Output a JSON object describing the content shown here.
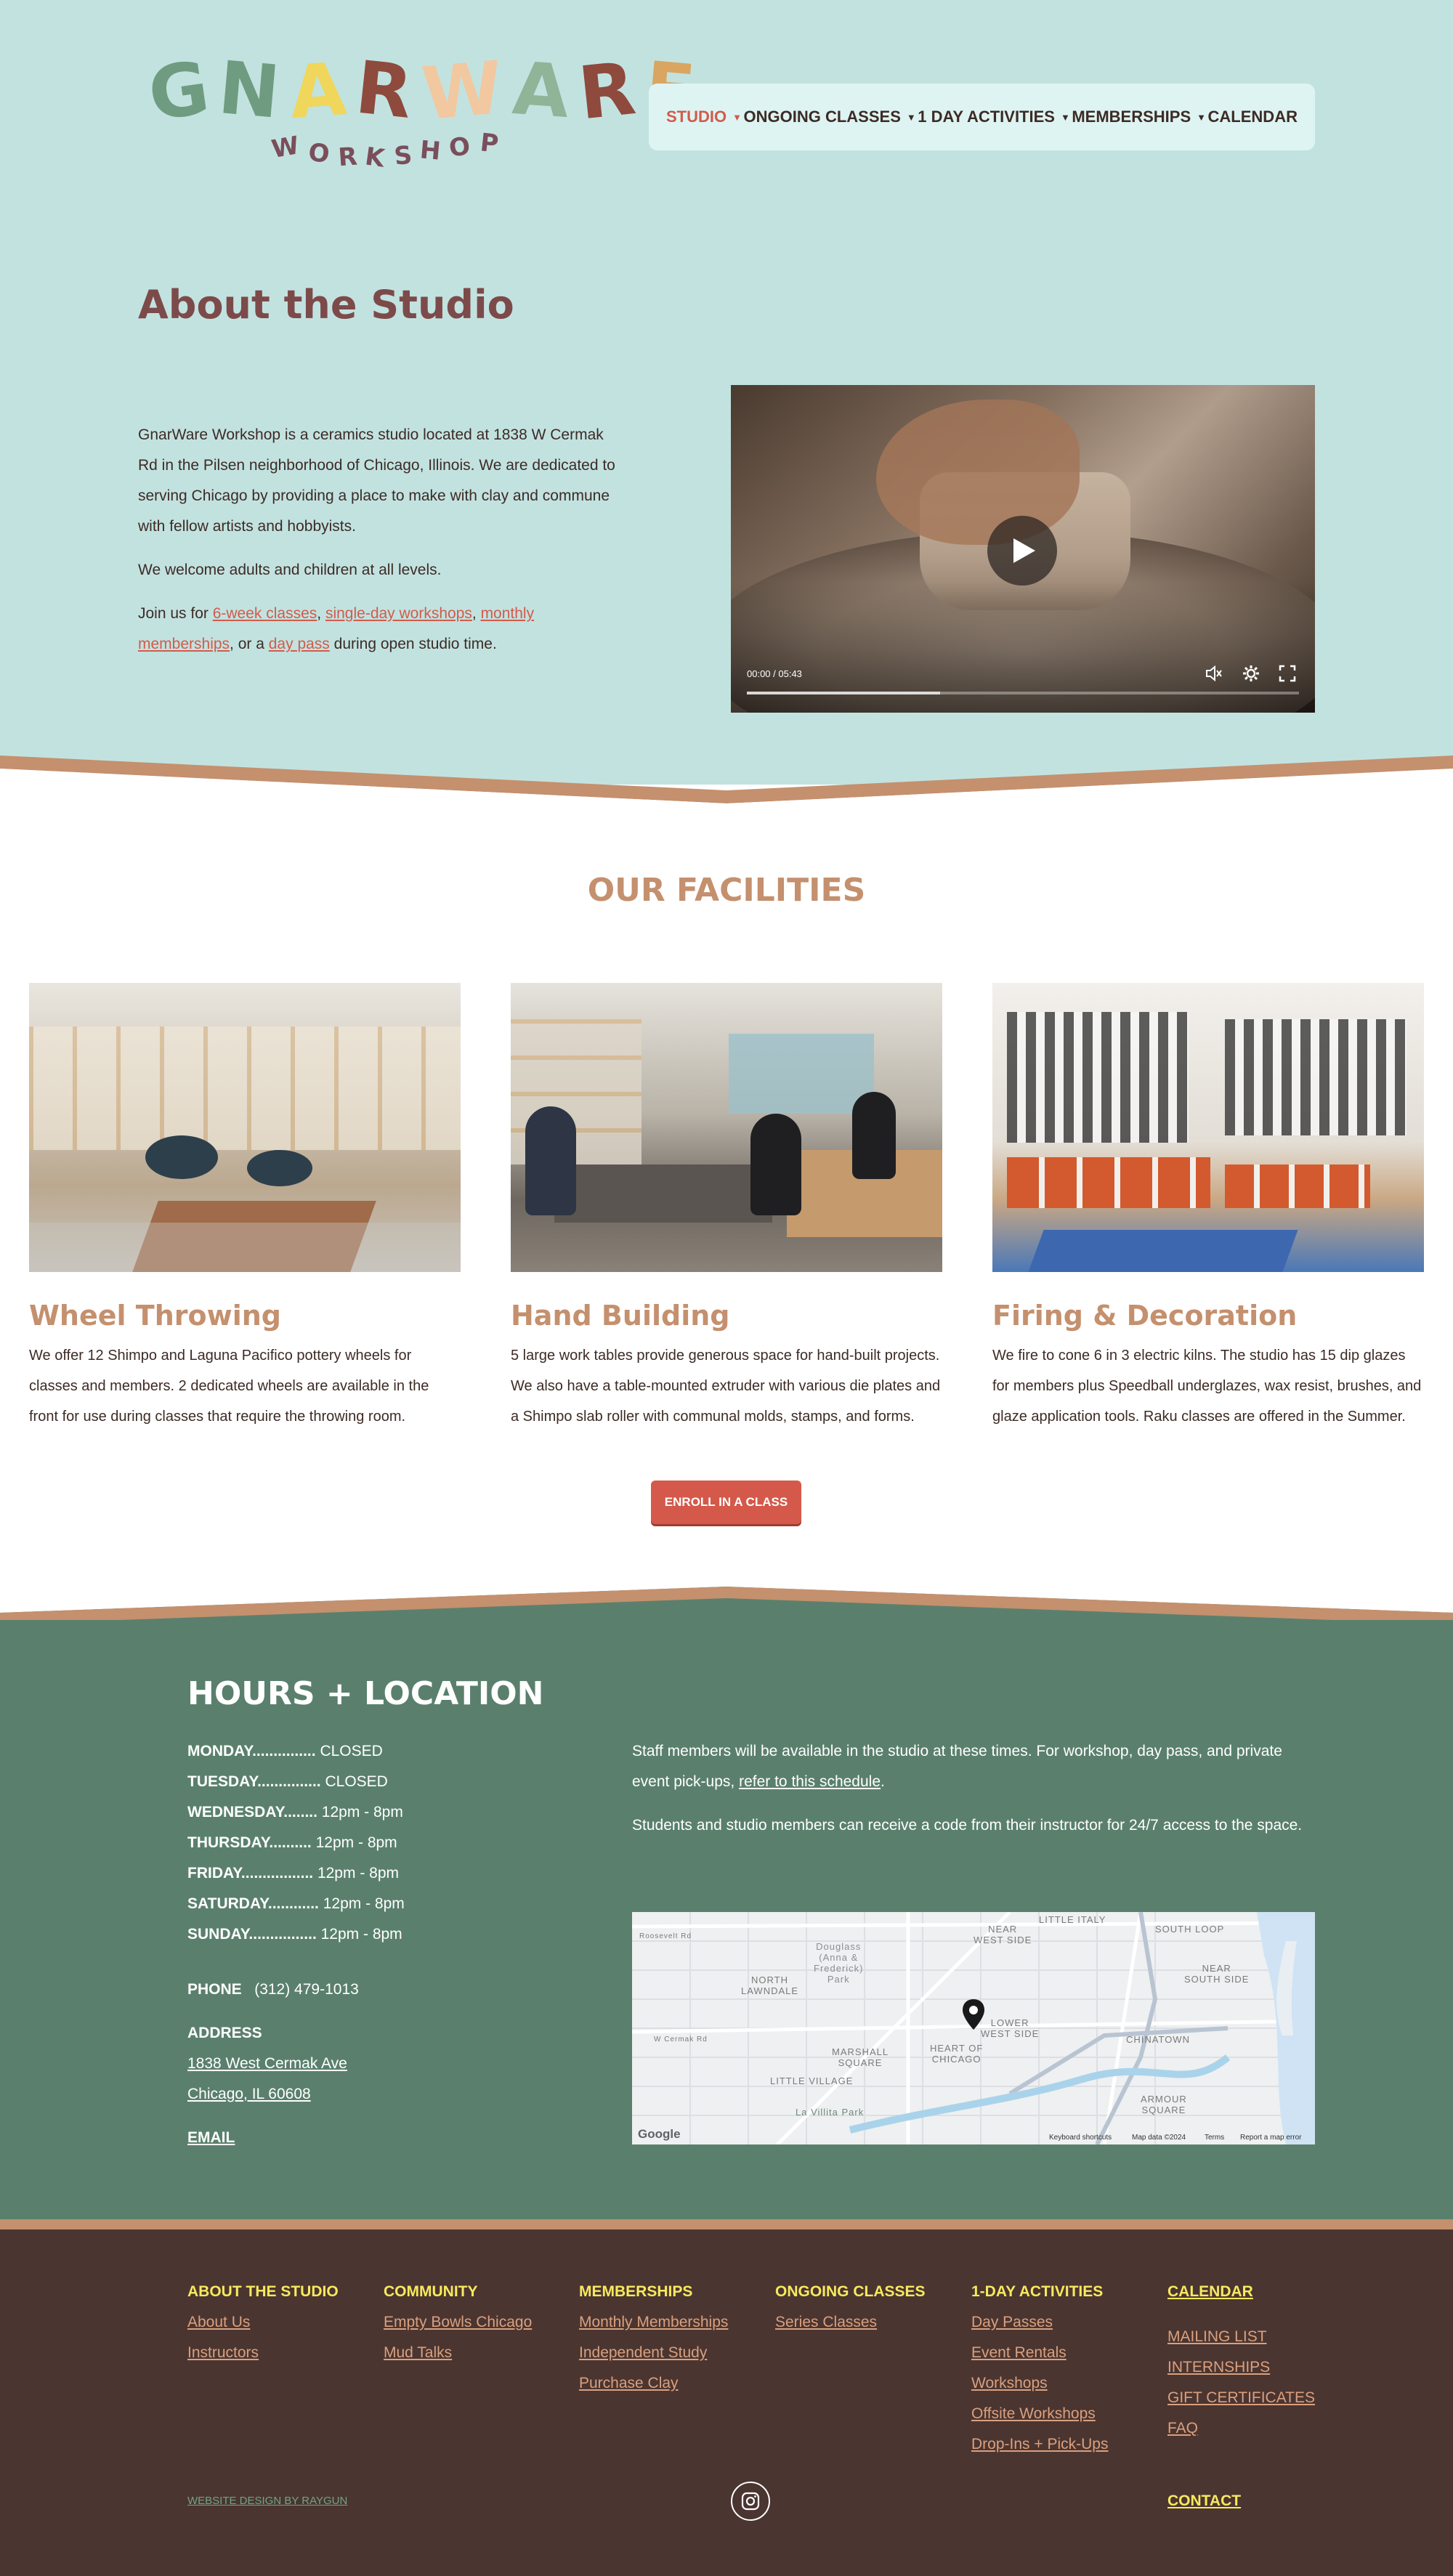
{
  "colors": {
    "hero_bg": "#c2e2e0",
    "accent_red": "#d25b4a",
    "tan": "#c4906e",
    "green": "#5a806d",
    "footer_bg": "#4b3530",
    "footer_heading": "#f6ea5e"
  },
  "logo": {
    "title": "GNARWARE",
    "subtitle": "WORKSHOP"
  },
  "nav": {
    "items": [
      {
        "label": "STUDIO",
        "active": true,
        "dropdown": true
      },
      {
        "label": "ONGOING CLASSES",
        "active": false,
        "dropdown": true
      },
      {
        "label": "1 DAY ACTIVITIES",
        "active": false,
        "dropdown": true
      },
      {
        "label": "MEMBERSHIPS",
        "active": false,
        "dropdown": true
      },
      {
        "label": "CALENDAR",
        "active": false,
        "dropdown": false
      }
    ],
    "caret_icon": "caret-down-icon"
  },
  "about": {
    "title": "About the Studio",
    "para1": "GnarWare Workshop is a ceramics studio located at 1838 W Cermak Rd in the Pilsen neighborhood of Chicago, Illinois. We are dedicated to serving Chicago by providing a place to make with clay and commune with fellow artists and hobbyists.",
    "para2": "We welcome adults and children at all levels.",
    "para3_prefix": "Join us for ",
    "link_classes": "6-week classes",
    "sep1": ", ",
    "link_workshops": "single-day workshops",
    "sep2": ", ",
    "link_memberships": "monthly memberships",
    "sep3": ", or a ",
    "link_daypass": "day pass",
    "para3_suffix": " during open studio time."
  },
  "video": {
    "time": "00:00 / 05:43",
    "progress": 0.35,
    "play_icon": "play-icon",
    "mute_icon": "speaker-icon",
    "settings_icon": "gear-icon",
    "fullscreen_icon": "fullscreen-icon"
  },
  "facilities": {
    "title": "OUR FACILITIES",
    "cards": [
      {
        "title": "Wheel Throwing",
        "text": "We offer 12 Shimpo and Laguna Pacifico pottery wheels for classes and members. 2 dedicated wheels are available in the front  for use during classes that require the throwing room."
      },
      {
        "title": "Hand Building",
        "text": "5 large work tables provide generous space for hand-built projects. We also have a table-mounted extruder with various die plates and a Shimpo slab roller with communal molds, stamps, and forms."
      },
      {
        "title": "Firing & Decoration",
        "text": "We fire to cone 6 in 3 electric kilns. The studio has 15 dip glazes for members plus Speedball underglazes, wax resist, brushes, and glaze application tools. Raku classes are offered in the Summer."
      }
    ],
    "enroll_label": "ENROLL IN A CLASS"
  },
  "hours": {
    "title": "HOURS + LOCATION",
    "days": [
      {
        "day": "MONDAY",
        "dots": "...............",
        "time": "CLOSED"
      },
      {
        "day": "TUESDAY",
        "dots": "...............",
        "time": "CLOSED"
      },
      {
        "day": "WEDNESDAY",
        "dots": "........",
        "time": "12pm - 8pm"
      },
      {
        "day": "THURSDAY",
        "dots": "..........",
        "time": "12pm - 8pm"
      },
      {
        "day": "FRIDAY",
        "dots": ".................",
        "time": "12pm - 8pm"
      },
      {
        "day": "SATURDAY",
        "dots": "............",
        "time": "12pm - 8pm"
      },
      {
        "day": "SUNDAY",
        "dots": "................",
        "time": "12pm - 8pm"
      }
    ],
    "phone_label": "PHONE",
    "phone": "(312) 479-1013",
    "address_label": "ADDRESS",
    "address_line1": "1838 West Cermak Ave",
    "address_line2": "Chicago, IL 60608",
    "email_label": "EMAIL",
    "note1_prefix": "Staff members will be available in the studio at these times. For workshop, day pass, and private event pick-ups, ",
    "note1_link": "refer to this schedule",
    "note1_suffix": ".",
    "note2": "Students and studio members can receive a code from their instructor for 24/7 access to the space."
  },
  "map": {
    "labels": {
      "little_italy": "LITTLE ITALY",
      "near_west_side": "NEAR\nWEST SIDE",
      "south_loop": "SOUTH LOOP",
      "near_south_side": "NEAR\nSOUTH SIDE",
      "douglass_park": "Douglass\n(Anna &\nFrederick)\nPark",
      "north_lawndale": "NORTH\nLAWNDALE",
      "lower_west_side": "LOWER\nWEST SIDE",
      "chinatown": "CHINATOWN",
      "marshall_square": "MARSHALL\nSQUARE",
      "heart_of_chicago": "HEART OF\nCHICAGO",
      "little_village": "LITTLE VILLAGE",
      "armour_square": "ARMOUR\nSQUARE",
      "la_villita_park": "La Villita Park",
      "w_cermak_rd": "W Cermak Rd",
      "roosevelt_rd": "Roosevelt Rd"
    },
    "google": "Google",
    "footer": {
      "shortcuts": "Keyboard shortcuts",
      "data": "Map data ©2024",
      "terms": "Terms",
      "report": "Report a map error"
    },
    "pin_icon": "map-pin-icon"
  },
  "footer": {
    "cols": [
      {
        "head": "ABOUT THE STUDIO",
        "links": [
          "About Us",
          "Instructors"
        ]
      },
      {
        "head": "COMMUNITY",
        "links": [
          "Empty Bowls Chicago",
          "Mud Talks"
        ]
      },
      {
        "head": "MEMBERSHIPS",
        "links": [
          "Monthly Memberships",
          "Independent Study",
          "Purchase Clay"
        ]
      },
      {
        "head": "ONGOING CLASSES",
        "links": [
          "Series Classes"
        ]
      },
      {
        "head": "1-DAY ACTIVITIES",
        "links": [
          "Day Passes",
          "Event Rentals",
          "Workshops",
          "Offsite Workshops",
          "Drop-Ins + Pick-Ups"
        ]
      }
    ],
    "last_col": {
      "head": "CALENDAR",
      "links": [
        "MAILING LIST",
        "INTERNSHIPS",
        "GIFT CERTIFICATES",
        "FAQ"
      ]
    },
    "credit": "WEBSITE DESIGN BY RAYGUN",
    "instagram_icon": "instagram-icon",
    "contact": "CONTACT"
  }
}
